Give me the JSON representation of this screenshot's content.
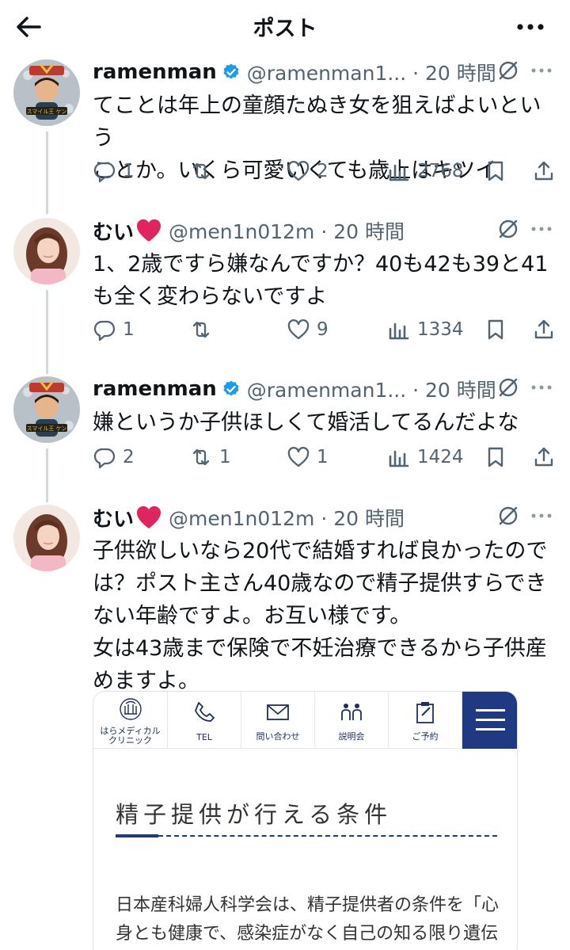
{
  "header": {
    "title": "ポスト"
  },
  "posts": [
    {
      "name": "ramenman",
      "handle": "@ramenman1... · 20 時間",
      "text": "てことは年上の童顔たぬき女を狙えばよいという\nことか。いくら可愛いくても歳上はキツイ",
      "replies": "1",
      "reposts": "",
      "likes": "2",
      "views": "2768",
      "verified": true
    },
    {
      "name": "むい",
      "handle": "@men1n012m · 20 時間",
      "text": "1、2歳ですら嫌なんですか？40も42も39と41\nも全く変わらないですよ",
      "replies": "1",
      "reposts": "",
      "likes": "9",
      "views": "1334",
      "verified": false
    },
    {
      "name": "ramenman",
      "handle": "@ramenman1... · 20 時間",
      "text": "嫌というか子供ほしくて婚活してるんだよな",
      "replies": "2",
      "reposts": "1",
      "likes": "1",
      "views": "1424",
      "verified": true
    },
    {
      "name": "むい",
      "handle": "@men1n012m · 20 時間",
      "text": "子供欲しいなら20代で結婚すれば良かったので\nは？ポスト主さん40歳なので精子提供すらでき\nない年齢ですよ。お互い様です。\n女は43歳まで保険で不妊治療できるから子供産\nめますよ。",
      "verified": false
    }
  ],
  "embed": {
    "logo_text": "はらメディカル\nクリニック",
    "nav": [
      "TEL",
      "問い合わせ",
      "説明会",
      "ご予約"
    ],
    "heading": "精子提供が行える条件",
    "body": "日本産科婦人科学会は、精子提供者の条件を「心\n身とも健康で、感染症がなく自己の知る限り遺伝"
  },
  "colors": {
    "accent": "#1d9bf0",
    "muted": "#536471",
    "clinic_navy": "#1f3a83",
    "heart": "#e0245e"
  }
}
